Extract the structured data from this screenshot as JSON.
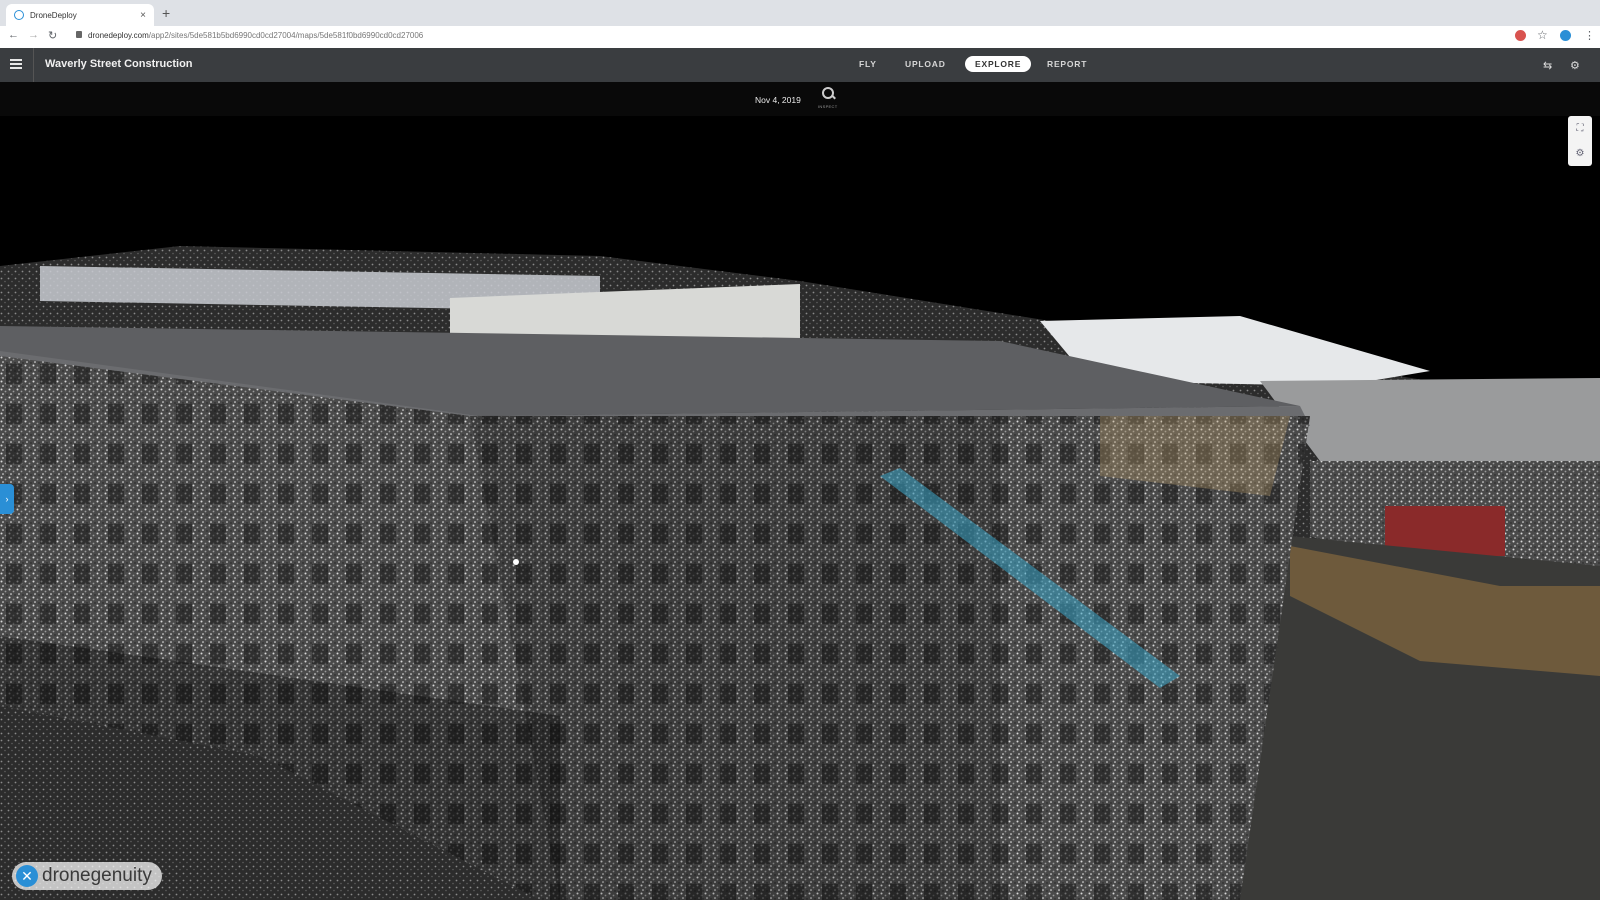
{
  "browser": {
    "tab_title": "DroneDeploy",
    "tab_close": "×",
    "new_tab": "+",
    "back": "←",
    "forward": "→",
    "reload": "↻",
    "url_domain": "dronedeploy.com",
    "url_path": "/app2/sites/5de581b5bd6990cd0cd27004/maps/5de581f0bd6990cd0cd27006",
    "star": "☆",
    "menu": "⋮"
  },
  "app": {
    "menu_icon": "hamburger-icon",
    "site_title": "Waverly Street Construction",
    "tabs": [
      {
        "label": "FLY"
      },
      {
        "label": "UPLOAD"
      },
      {
        "label": "EXPLORE",
        "active": true
      },
      {
        "label": "REPORT"
      }
    ],
    "share_icon": "⇆",
    "settings_icon": "⚙"
  },
  "viewer": {
    "date": "Nov 4, 2019",
    "inspect_label": "INSPECT",
    "tools": [
      "⛶",
      "⚙"
    ],
    "side_handle": "›",
    "accent": "#2a8fd6"
  },
  "watermark": {
    "mark": "✕",
    "text": "dronegenuity"
  }
}
